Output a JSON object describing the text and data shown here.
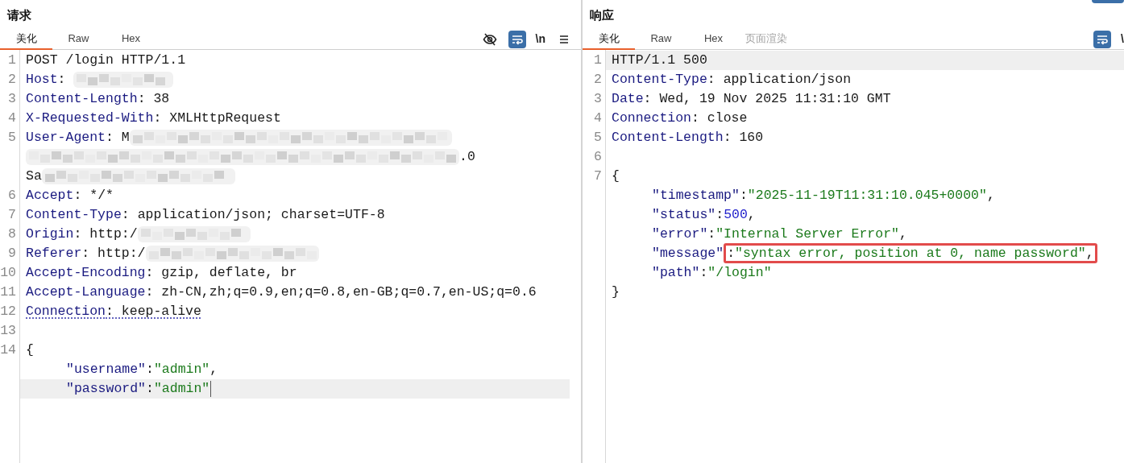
{
  "panes": [
    {
      "title": "请求",
      "tabs": [
        {
          "label": "美化",
          "selected": true,
          "disabled": false
        },
        {
          "label": "Raw",
          "selected": false,
          "disabled": false
        },
        {
          "label": "Hex",
          "selected": false,
          "disabled": false
        }
      ],
      "tools": [
        {
          "kind": "eye-off",
          "selected": false
        },
        {
          "kind": "wrap",
          "selected": true
        },
        {
          "kind": "text",
          "text": "\\n",
          "selected": false
        },
        {
          "kind": "menu",
          "selected": false
        }
      ],
      "lines": [
        {
          "number": "1",
          "current": false,
          "caret": false,
          "underlined": false,
          "indented": false,
          "tokens": [
            {
              "kind": "text",
              "text": "POST /login HTTP/1.1"
            }
          ]
        },
        {
          "number": "2",
          "current": false,
          "caret": false,
          "underlined": false,
          "indented": false,
          "tokens": [
            {
              "kind": "name",
              "text": "Host"
            },
            {
              "kind": "text",
              "text": ": "
            },
            {
              "kind": "redacted"
            }
          ]
        },
        {
          "number": "3",
          "current": false,
          "caret": false,
          "underlined": false,
          "indented": false,
          "tokens": [
            {
              "kind": "name",
              "text": "Content-Length"
            },
            {
              "kind": "text",
              "text": ": 38"
            }
          ]
        },
        {
          "number": "4",
          "current": false,
          "caret": false,
          "underlined": false,
          "indented": false,
          "tokens": [
            {
              "kind": "name",
              "text": "X-Requested-With"
            },
            {
              "kind": "text",
              "text": ": XMLHttpRequest"
            }
          ]
        },
        {
          "number": "5",
          "current": false,
          "caret": false,
          "underlined": false,
          "indented": false,
          "tokens": [
            {
              "kind": "name",
              "text": "User-Agent"
            },
            {
              "kind": "text",
              "text": ": M"
            },
            {
              "kind": "redacted"
            },
            {
              "kind": "break"
            },
            {
              "kind": "redacted"
            },
            {
              "kind": "text",
              "text": ".0"
            },
            {
              "kind": "break"
            },
            {
              "kind": "text",
              "text": "Sa"
            },
            {
              "kind": "redacted"
            }
          ]
        },
        {
          "number": "6",
          "current": false,
          "caret": false,
          "underlined": false,
          "indented": false,
          "tokens": [
            {
              "kind": "name",
              "text": "Accept"
            },
            {
              "kind": "text",
              "text": ": */*"
            }
          ]
        },
        {
          "number": "7",
          "current": false,
          "caret": false,
          "underlined": false,
          "indented": false,
          "tokens": [
            {
              "kind": "name",
              "text": "Content-Type"
            },
            {
              "kind": "text",
              "text": ": application/json; charset=UTF-8"
            }
          ]
        },
        {
          "number": "8",
          "current": false,
          "caret": false,
          "underlined": false,
          "indented": false,
          "tokens": [
            {
              "kind": "name",
              "text": "Origin"
            },
            {
              "kind": "text",
              "text": ": http:/"
            },
            {
              "kind": "redacted"
            }
          ]
        },
        {
          "number": "9",
          "current": false,
          "caret": false,
          "underlined": false,
          "indented": false,
          "tokens": [
            {
              "kind": "name",
              "text": "Referer"
            },
            {
              "kind": "text",
              "text": ": http:/"
            },
            {
              "kind": "redacted"
            }
          ]
        },
        {
          "number": "10",
          "current": false,
          "caret": false,
          "underlined": false,
          "indented": false,
          "tokens": [
            {
              "kind": "name",
              "text": "Accept-Encoding"
            },
            {
              "kind": "text",
              "text": ": gzip, deflate, br"
            }
          ]
        },
        {
          "number": "11",
          "current": false,
          "caret": false,
          "underlined": false,
          "indented": false,
          "tokens": [
            {
              "kind": "name",
              "text": "Accept-Language"
            },
            {
              "kind": "text",
              "text": ": zh-CN,zh;q=0.9,en;q=0.8,en-GB;q=0.7,en-US;q=0.6"
            }
          ]
        },
        {
          "number": "12",
          "current": false,
          "caret": false,
          "underlined": true,
          "indented": false,
          "tokens": [
            {
              "kind": "name",
              "text": "Connection"
            },
            {
              "kind": "text",
              "text": ": keep-alive"
            }
          ]
        },
        {
          "number": "13",
          "current": false,
          "caret": false
        },
        {
          "number": "14",
          "current": false,
          "caret": false,
          "underlined": false,
          "indented": false,
          "tokens": [
            {
              "kind": "text",
              "text": "{"
            }
          ]
        },
        {
          "current": false,
          "caret": false,
          "underlined": false,
          "indented": true,
          "tokens": [
            {
              "kind": "key",
              "text": "\"username\""
            },
            {
              "kind": "text",
              "text": ":"
            },
            {
              "kind": "string",
              "text": "\"admin\""
            },
            {
              "kind": "text",
              "text": ","
            }
          ]
        },
        {
          "current": true,
          "caret": true,
          "underlined": false,
          "indented": true,
          "tokens": [
            {
              "kind": "key",
              "text": "\"password\""
            },
            {
              "kind": "text",
              "text": ":"
            },
            {
              "kind": "string",
              "text": "\"admin\""
            }
          ]
        }
      ]
    },
    {
      "title": "响应",
      "tabs": [
        {
          "label": "美化",
          "selected": true,
          "disabled": false
        },
        {
          "label": "Raw",
          "selected": false,
          "disabled": false
        },
        {
          "label": "Hex",
          "selected": false,
          "disabled": false
        },
        {
          "label": "页面渲染",
          "selected": false,
          "disabled": true
        }
      ],
      "tools": [
        {
          "kind": "wrap",
          "selected": true
        },
        {
          "kind": "text",
          "text": "\\",
          "selected": false
        }
      ],
      "lines": [
        {
          "number": "1",
          "current": true,
          "caret": false,
          "underlined": false,
          "indented": false,
          "tokens": [
            {
              "kind": "text",
              "text": "HTTP/1.1 500"
            }
          ]
        },
        {
          "number": "2",
          "current": false,
          "caret": false,
          "underlined": false,
          "indented": false,
          "tokens": [
            {
              "kind": "name",
              "text": "Content-Type"
            },
            {
              "kind": "text",
              "text": ": application/json"
            }
          ]
        },
        {
          "number": "3",
          "current": false,
          "caret": false,
          "underlined": false,
          "indented": false,
          "tokens": [
            {
              "kind": "name",
              "text": "Date"
            },
            {
              "kind": "text",
              "text": ": Wed, 19 Nov 2025 11:31:10 GMT"
            }
          ]
        },
        {
          "number": "4",
          "current": false,
          "caret": false,
          "underlined": false,
          "indented": false,
          "tokens": [
            {
              "kind": "name",
              "text": "Connection"
            },
            {
              "kind": "text",
              "text": ": close"
            }
          ]
        },
        {
          "number": "5",
          "current": false,
          "caret": false,
          "underlined": false,
          "indented": false,
          "tokens": [
            {
              "kind": "name",
              "text": "Content-Length"
            },
            {
              "kind": "text",
              "text": ": 160"
            }
          ]
        },
        {
          "number": "6",
          "current": false,
          "caret": false
        },
        {
          "number": "7",
          "current": false,
          "caret": false,
          "underlined": false,
          "indented": false,
          "tokens": [
            {
              "kind": "text",
              "text": "{"
            }
          ]
        },
        {
          "current": false,
          "caret": false,
          "underlined": false,
          "indented": true,
          "tokens": [
            {
              "kind": "key",
              "text": "\"timestamp\""
            },
            {
              "kind": "text",
              "text": ":"
            },
            {
              "kind": "string",
              "text": "\"2025-11-19T11:31:10.045+0000\""
            },
            {
              "kind": "text",
              "text": ","
            }
          ]
        },
        {
          "current": false,
          "caret": false,
          "underlined": false,
          "indented": true,
          "tokens": [
            {
              "kind": "key",
              "text": "\"status\""
            },
            {
              "kind": "text",
              "text": ":"
            },
            {
              "kind": "number",
              "text": "500"
            },
            {
              "kind": "text",
              "text": ","
            }
          ]
        },
        {
          "current": false,
          "caret": false,
          "underlined": false,
          "indented": true,
          "tokens": [
            {
              "kind": "key",
              "text": "\"error\""
            },
            {
              "kind": "text",
              "text": ":"
            },
            {
              "kind": "string",
              "text": "\"Internal Server Error\""
            },
            {
              "kind": "text",
              "text": ","
            }
          ]
        },
        {
          "current": false,
          "caret": false,
          "underlined": false,
          "indented": true,
          "tokens": [
            {
              "kind": "key",
              "text": "\"message\"",
              "boxed": false
            },
            {
              "kind": "text",
              "text": ":",
              "boxed": true
            },
            {
              "kind": "string",
              "text": "\"syntax error, position at 0, name password\"",
              "boxed": true
            },
            {
              "kind": "text",
              "text": ",",
              "boxed": true
            }
          ]
        },
        {
          "current": false,
          "caret": false,
          "underlined": false,
          "indented": true,
          "tokens": [
            {
              "kind": "key",
              "text": "\"path\""
            },
            {
              "kind": "text",
              "text": ":"
            },
            {
              "kind": "string",
              "text": "\"/login\""
            }
          ]
        },
        {
          "current": false,
          "caret": false,
          "underlined": false,
          "indented": false,
          "tokens": [
            {
              "kind": "text",
              "text": "}"
            }
          ]
        }
      ]
    }
  ]
}
